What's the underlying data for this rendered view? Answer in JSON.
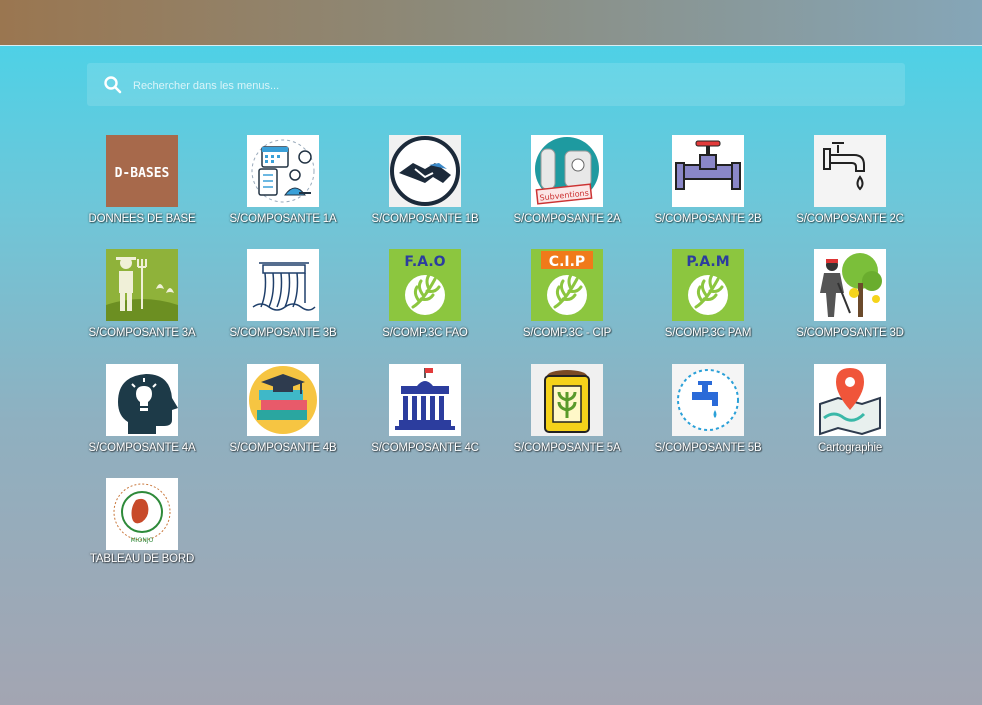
{
  "search": {
    "placeholder": "Rechercher dans les menus..."
  },
  "tiles": [
    {
      "label": "DONNEES DE BASE",
      "image_text": "D-BASES",
      "icon": "database-icon"
    },
    {
      "label": "S/COMPOSANTE 1A",
      "icon": "planning-icon"
    },
    {
      "label": "S/COMPOSANTE 1B",
      "icon": "handshake-icon"
    },
    {
      "label": "S/COMPOSANTE 2A",
      "image_text": "Subventions",
      "icon": "subvention-icon"
    },
    {
      "label": "S/COMPOSANTE 2B",
      "icon": "pipe-valve-icon"
    },
    {
      "label": "S/COMPOSANTE 2C",
      "icon": "water-tap-icon"
    },
    {
      "label": "S/COMPOSANTE 3A",
      "icon": "farmer-icon"
    },
    {
      "label": "S/COMPOSANTE 3B",
      "icon": "dam-icon"
    },
    {
      "label": "S/COMP.3C FAO",
      "image_text": "F.A.O",
      "icon": "wheat-fao-icon"
    },
    {
      "label": "S/COMP.3C - CIP",
      "image_text": "C.I.P",
      "icon": "wheat-cip-icon"
    },
    {
      "label": "S/COMP.3C PAM",
      "image_text": "P.A.M",
      "icon": "wheat-pam-icon"
    },
    {
      "label": "S/COMPOSANTE 3D",
      "icon": "planting-tree-icon"
    },
    {
      "label": "S/COMPOSANTE 4A",
      "icon": "head-lightbulb-icon"
    },
    {
      "label": "S/COMPOSANTE 4B",
      "icon": "graduation-books-icon"
    },
    {
      "label": "S/COMPOSANTE 4C",
      "icon": "government-building-icon"
    },
    {
      "label": "S/COMPOSANTE 5A",
      "icon": "grain-sack-icon"
    },
    {
      "label": "S/COMPOSANTE 5B",
      "icon": "water-faucet-icon"
    },
    {
      "label": "Cartographie",
      "icon": "map-pin-icon"
    },
    {
      "label": "TABLEAU DE BORD",
      "image_text": "MIONJO",
      "icon": "mionjo-logo-icon"
    }
  ]
}
